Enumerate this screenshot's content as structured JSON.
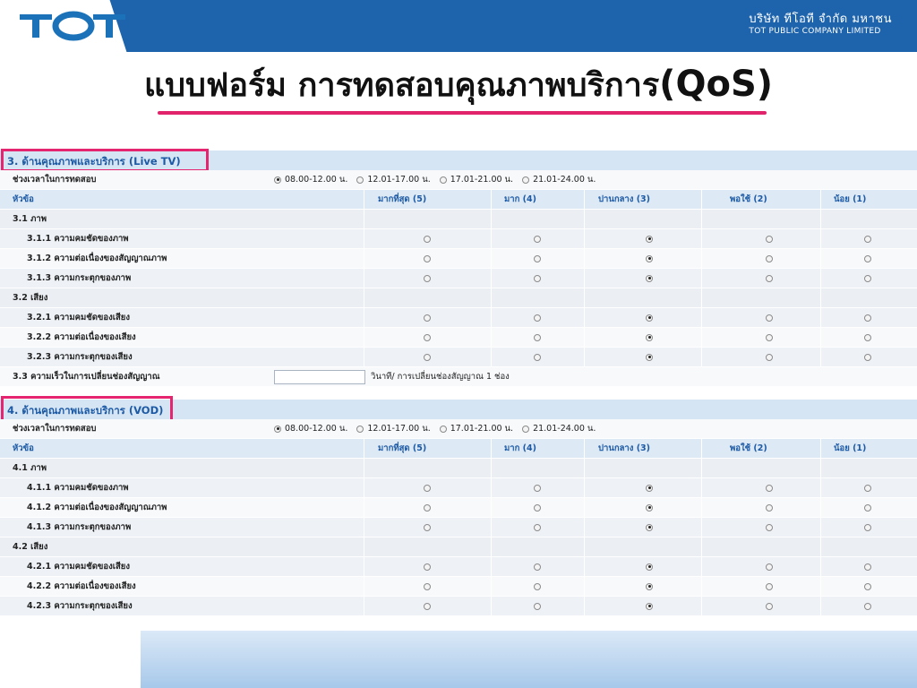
{
  "header": {
    "logo_text": "TOT",
    "company_th": "บริษัท ทีโอที จำกัด มหาชน",
    "company_en": "TOT PUBLIC COMPANY LIMITED",
    "brand_color": "#1e64ad"
  },
  "title": {
    "main": "แบบฟอร์ม การทดสอบคุณภาพบริการ",
    "suffix": "(QoS)",
    "accent_color": "#e0236b"
  },
  "columns": {
    "topic": "หัวข้อ",
    "c5": "มากที่สุด (5)",
    "c4": "มาก (4)",
    "c3": "ปานกลาง (3)",
    "c2": "พอใช้ (2)",
    "c1": "น้อย (1)"
  },
  "time_label": "ช่วงเวลาในการทดสอบ",
  "time_options": [
    "08.00-12.00 น.",
    "12.01-17.00 น.",
    "17.01-21.00 น.",
    "21.01-24.00 น."
  ],
  "sections": [
    {
      "title": "3. ด้านคุณภาพและบริการ (Live TV)",
      "selected_time": 0,
      "groups": [
        {
          "label": "3.1 ภาพ",
          "items": [
            {
              "label": "3.1.1 ความคมชัดของภาพ",
              "selected": 3
            },
            {
              "label": "3.1.2 ความต่อเนื่องของสัญญาณภาพ",
              "selected": 3
            },
            {
              "label": "3.1.3 ความกระตุกของภาพ",
              "selected": 3
            }
          ]
        },
        {
          "label": "3.2 เสียง",
          "items": [
            {
              "label": "3.2.1 ความคมชัดของเสียง",
              "selected": 3
            },
            {
              "label": "3.2.2 ความต่อเนื่องของเสียง",
              "selected": 3
            },
            {
              "label": "3.2.3 ความกระตุกของเสียง",
              "selected": 3
            }
          ]
        }
      ],
      "speed_label": "3.3 ความเร็วในการเปลี่ยนช่องสัญญาณ",
      "speed_value": "",
      "speed_unit": "วินาที/ การเปลี่ยนช่องสัญญาณ 1 ช่อง"
    },
    {
      "title": "4. ด้านคุณภาพและบริการ (VOD)",
      "selected_time": 0,
      "groups": [
        {
          "label": "4.1 ภาพ",
          "items": [
            {
              "label": "4.1.1 ความคมชัดของภาพ",
              "selected": 3
            },
            {
              "label": "4.1.2 ความต่อเนื่องของสัญญาณภาพ",
              "selected": 3
            },
            {
              "label": "4.1.3 ความกระตุกของภาพ",
              "selected": 3
            }
          ]
        },
        {
          "label": "4.2 เสียง",
          "items": [
            {
              "label": "4.2.1 ความคมชัดของเสียง",
              "selected": 3
            },
            {
              "label": "4.2.2 ความต่อเนื่องของเสียง",
              "selected": 3
            },
            {
              "label": "4.2.3 ความกระตุกของเสียง",
              "selected": 3
            }
          ]
        }
      ]
    }
  ]
}
